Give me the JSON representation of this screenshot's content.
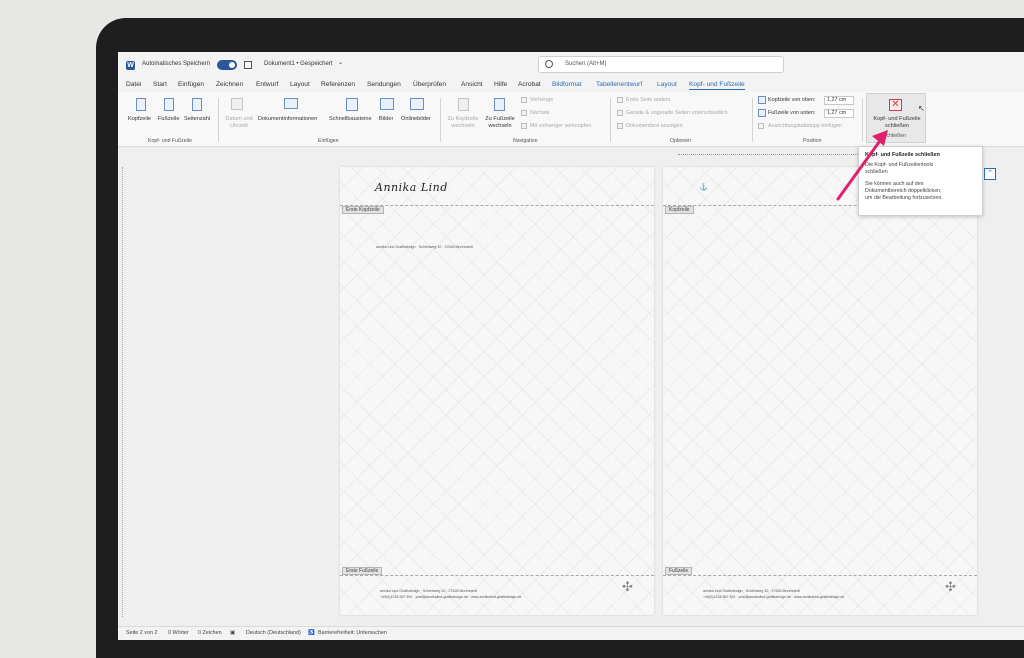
{
  "titlebar": {
    "autosave_label": "Automatisches Speichern",
    "doc_title": "Dokument1 • Gespeichert",
    "doc_chevron": "⌄",
    "search_placeholder": "Suchen (Alt+M)"
  },
  "tabs": [
    {
      "label": "Datei"
    },
    {
      "label": "Start"
    },
    {
      "label": "Einfügen"
    },
    {
      "label": "Zeichnen"
    },
    {
      "label": "Entwurf"
    },
    {
      "label": "Layout"
    },
    {
      "label": "Referenzen"
    },
    {
      "label": "Sendungen"
    },
    {
      "label": "Überprüfen"
    },
    {
      "label": "Ansicht"
    },
    {
      "label": "Hilfe"
    },
    {
      "label": "Acrobat"
    },
    {
      "label": "Bildformat"
    },
    {
      "label": "Tabellenentwurf"
    },
    {
      "label": "Layout"
    },
    {
      "label": "Kopf- und Fußzeile"
    }
  ],
  "ribbon": {
    "group1": {
      "label": "Kopf- und Fußzeile",
      "buttons": [
        "Kopfzeile",
        "Fußzeile",
        "Seitenzahl"
      ]
    },
    "group2": {
      "label": "Einfügen",
      "buttons": [
        "Datum und Uhrzeit",
        "Dokumentinformationen",
        "Schnellbausteine",
        "Bilder",
        "Onlinebilder"
      ]
    },
    "group3": {
      "label": "Navigation",
      "buttons": [
        "Zu Kopfzeile wechseln",
        "Zu Fußzeile wechseln"
      ],
      "small": [
        "Vorherige",
        "Nächste",
        "Mit vorheriger verknüpfen"
      ]
    },
    "group4": {
      "label": "Optionen",
      "checks": [
        "Erste Seite anders",
        "Gerade & ungerade Seiten unterschiedlich",
        "Dokumenttext anzeigen"
      ]
    },
    "group5": {
      "label": "Position",
      "rows": [
        {
          "label": "Kopfzeile von oben:",
          "value": "1,27 cm"
        },
        {
          "label": "Fußzeile von unten:",
          "value": "1,27 cm"
        }
      ],
      "align": "Ausrichtungstabstopp einfügen"
    },
    "group6": {
      "label": "Schließen",
      "button": "Kopf- und Fußzeile schließen"
    }
  },
  "tooltip": {
    "title": "Kopf- und Fußzeile schließen",
    "line1": "Die Kopf- und Fußzeilentools",
    "line2": "schließen",
    "line3": "Sie können auch auf den",
    "line4": "Dokumentbereich doppelklicken,",
    "line5": "um die Bearbeitung fortzusetzen."
  },
  "page1": {
    "header_tag": "Erste Kopfzeile",
    "footer_tag": "Erste Fußzeile",
    "signature": "Annika Lind",
    "address": "annika Lind Grafikdesign · Schlehweg 10 · 27628 Beverstedt",
    "footer1": "annika Lind Grafikdesign · Schlehweg 10 · 27628 Beverstedt",
    "footer2": "+49(0)1234 567 891 · post@annikalind-grafikdesign.de · www.annikalind-grafikdesign.de"
  },
  "page2": {
    "header_tag": "Kopfzeile",
    "footer_tag": "Fußzeile",
    "footer1": "annika Lind Grafikdesign · Schlehweg 10 · 27628 Beverstedt",
    "footer2": "+49(0)1234 567 891 · post@annikalind-grafikdesign.de · www.annikalind-grafikdesign.de"
  },
  "statusbar": {
    "page": "Seite 2 von 2",
    "words": "0 Wörter",
    "chars": "0 Zeichen",
    "language": "Deutsch (Deutschland)",
    "accessibility": "Barrierefreiheit: Untersuchen"
  },
  "colors": {
    "accent": "#2b6cb0",
    "arrow": "#e0206e"
  }
}
